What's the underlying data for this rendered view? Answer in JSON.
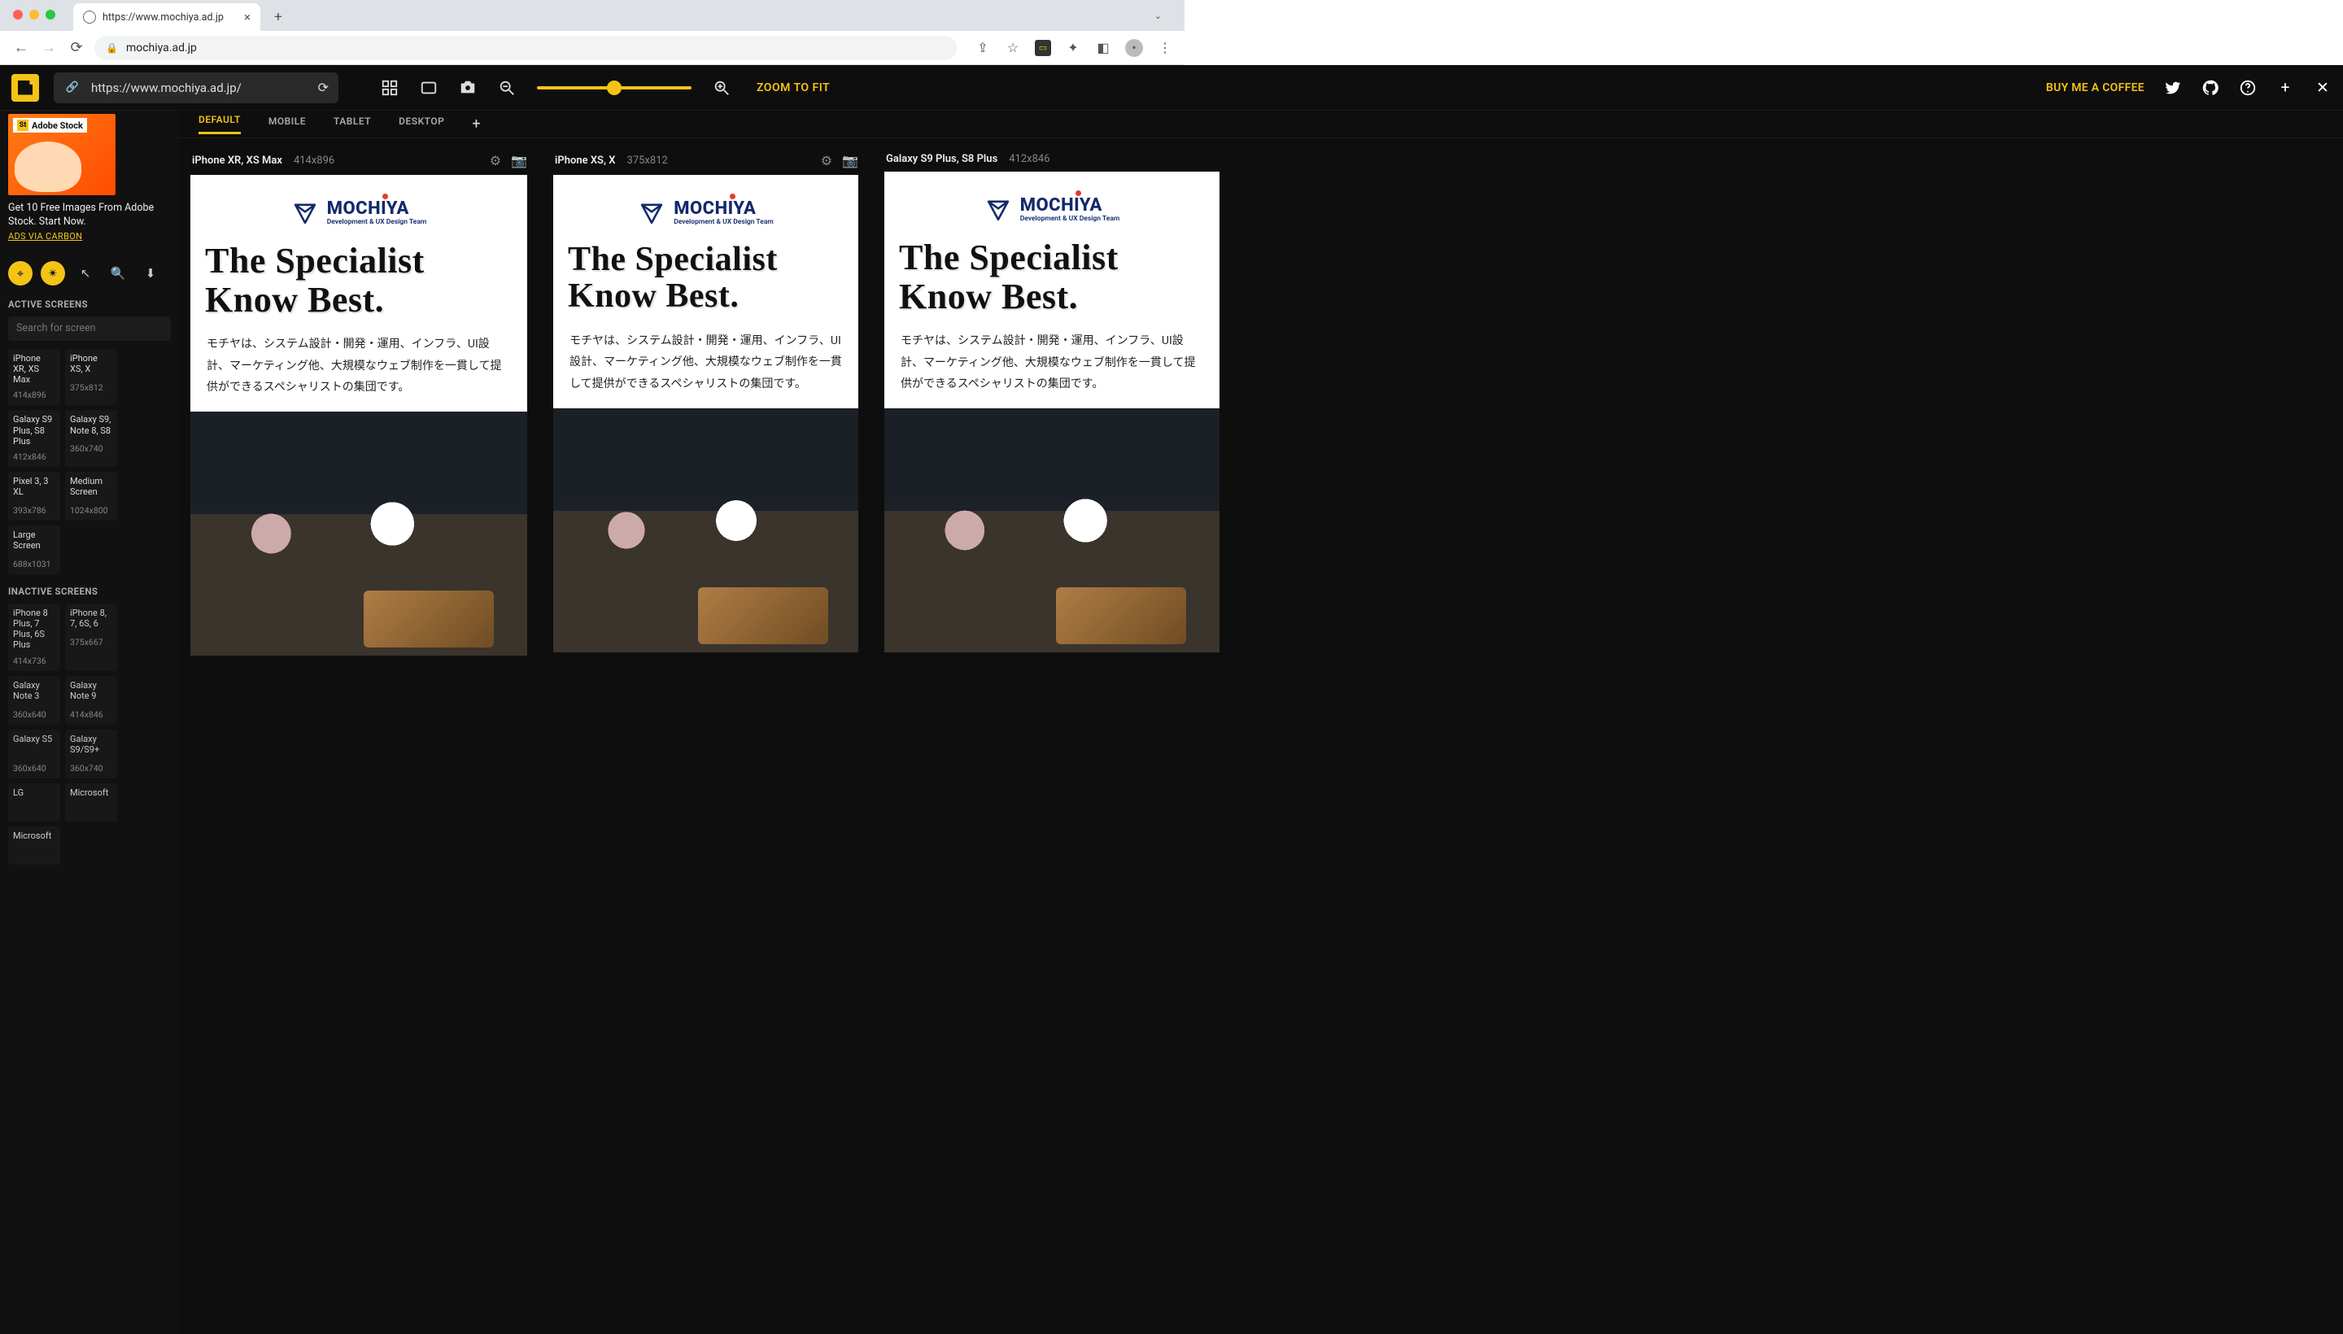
{
  "browser": {
    "tab_title": "https://www.mochiya.ad.jp",
    "omnibox": "mochiya.ad.jp"
  },
  "appbar": {
    "url": "https://www.mochiya.ad.jp/",
    "zoom_to_fit": "ZOOM TO FIT",
    "buy_me_a_coffee": "BUY ME A COFFEE"
  },
  "ad": {
    "badge": "Adobe Stock",
    "text": "Get 10 Free Images From Adobe Stock. Start Now.",
    "via": "ADS VIA CARBON"
  },
  "sidebar": {
    "active_h": "ACTIVE SCREENS",
    "inactive_h": "INACTIVE SCREENS",
    "search_ph": "Search for screen",
    "active": [
      {
        "n": "iPhone XR, XS Max",
        "d": "414x896"
      },
      {
        "n": "iPhone XS, X",
        "d": "375x812"
      },
      {
        "n": "Galaxy S9 Plus, S8 Plus",
        "d": "412x846"
      },
      {
        "n": "Galaxy S9, Note 8, S8",
        "d": "360x740"
      },
      {
        "n": "Pixel 3, 3 XL",
        "d": "393x786"
      },
      {
        "n": "Medium Screen",
        "d": "1024x800"
      },
      {
        "n": "Large Screen",
        "d": "688x1031"
      }
    ],
    "inactive": [
      {
        "n": "iPhone 8 Plus, 7 Plus, 6S Plus",
        "d": "414x736"
      },
      {
        "n": "iPhone 8, 7, 6S, 6",
        "d": "375x667"
      },
      {
        "n": "Galaxy Note 3",
        "d": "360x640"
      },
      {
        "n": "Galaxy Note 9",
        "d": "414x846"
      },
      {
        "n": "Galaxy S5",
        "d": "360x640"
      },
      {
        "n": "Galaxy S9/S9+",
        "d": "360x740"
      },
      {
        "n": "LG",
        "d": ""
      },
      {
        "n": "Microsoft",
        "d": ""
      },
      {
        "n": "Microsoft",
        "d": ""
      }
    ]
  },
  "tabs": {
    "default": "DEFAULT",
    "mobile": "MOBILE",
    "tablet": "TABLET",
    "desktop": "DESKTOP"
  },
  "previews": [
    {
      "name": "iPhone XR, XS Max",
      "dim": "414x896"
    },
    {
      "name": "iPhone XS, X",
      "dim": "375x812"
    },
    {
      "name": "Galaxy S9 Plus, S8 Plus",
      "dim": "412x846"
    }
  ],
  "site": {
    "brand": "MOCHIYA",
    "brand_sub": "Development & UX Design Team",
    "hero": "The Specialist Know Best.",
    "jp": "モチヤは、システム設計・開発・運用、インフラ、UI設計、マーケティング他、大規模なウェブ制作を一貫して提供ができるスペシャリストの集団です。"
  }
}
